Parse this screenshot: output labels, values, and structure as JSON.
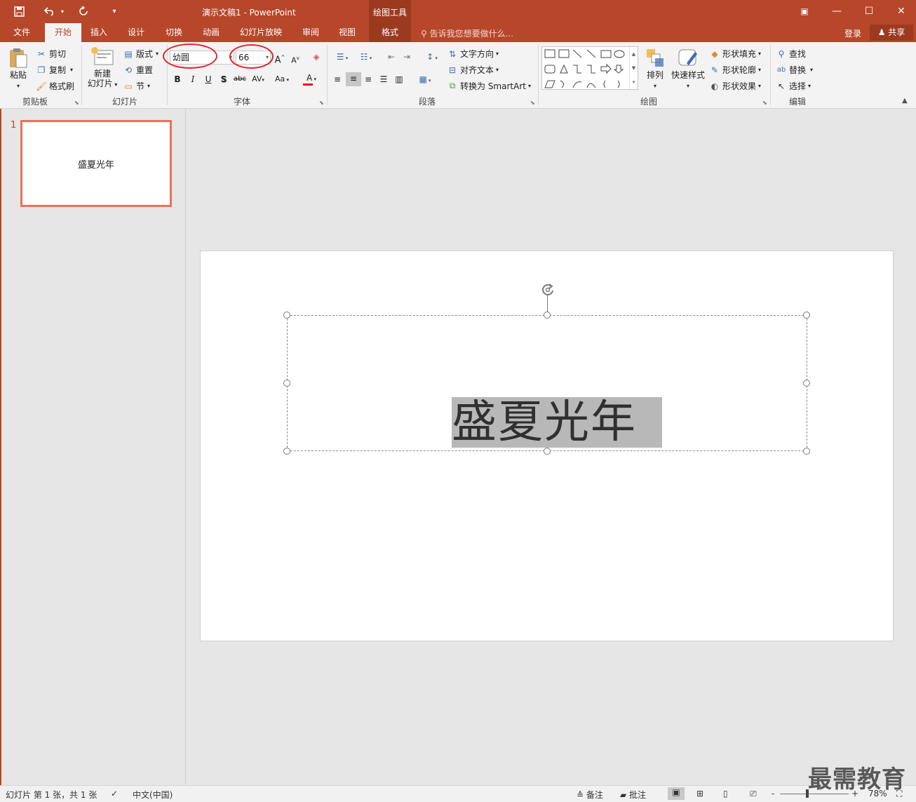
{
  "window": {
    "title": "演示文稿1 - PowerPoint",
    "context_group": "绘图工具",
    "quick_access": {
      "save": "save-icon",
      "undo": "undo-icon",
      "redo": "repeat-icon",
      "customize": "▾"
    },
    "controls": {
      "ribbon_options": "▣",
      "minimize": "—",
      "restore": "☐",
      "close": "✕"
    }
  },
  "tabs": [
    {
      "label": "文件"
    },
    {
      "label": "开始"
    },
    {
      "label": "插入"
    },
    {
      "label": "设计"
    },
    {
      "label": "切换"
    },
    {
      "label": "动画"
    },
    {
      "label": "幻灯片放映"
    },
    {
      "label": "审阅"
    },
    {
      "label": "视图"
    },
    {
      "label": "格式"
    }
  ],
  "active_tab": "开始",
  "tell_me": "告诉我您想要做什么...",
  "account": {
    "signin": "登录",
    "share": "共享"
  },
  "ribbon": {
    "clipboard": {
      "label": "剪贴板",
      "paste": "粘贴",
      "cut": "剪切",
      "copy": "复制",
      "format_painter": "格式刷"
    },
    "slides": {
      "label": "幻灯片",
      "new_slide_1": "新建",
      "new_slide_2": "幻灯片",
      "layout": "版式",
      "reset": "重置",
      "section": "节"
    },
    "font": {
      "label": "字体",
      "font_name": "幼圆",
      "font_size": "66",
      "bold": "B",
      "italic": "I",
      "underline": "U",
      "shadow": "S",
      "strike": "abc",
      "spacing": "AV",
      "case": "Aa",
      "color": "A",
      "grow": "A",
      "shrink": "A"
    },
    "paragraph": {
      "label": "段落",
      "text_direction": "文字方向",
      "align_text": "对齐文本",
      "smartart": "转换为 SmartArt"
    },
    "drawing": {
      "label": "绘图",
      "arrange": "排列",
      "quick_styles": "快速样式",
      "shape_fill": "形状填充",
      "shape_outline": "形状轮廓",
      "shape_effects": "形状效果"
    },
    "editing": {
      "label": "编辑",
      "find": "查找",
      "replace": "替换",
      "select": "选择"
    }
  },
  "slides_pane": {
    "number": "1",
    "thumb_text": "盛夏光年"
  },
  "slide": {
    "text": "盛夏光年"
  },
  "status": {
    "slide_info": "幻灯片 第 1 张，共 1 张",
    "language": "中文(中国)",
    "notes": "备注",
    "comments": "批注",
    "zoom_minus": "-",
    "zoom_plus": "+",
    "zoom": "78%",
    "zoom_level": 0.4
  },
  "watermark": "最需教育",
  "colors": {
    "accent": "#b7472a",
    "highlight_ring": "#e0252d",
    "font_color_bar": "#e81123"
  }
}
